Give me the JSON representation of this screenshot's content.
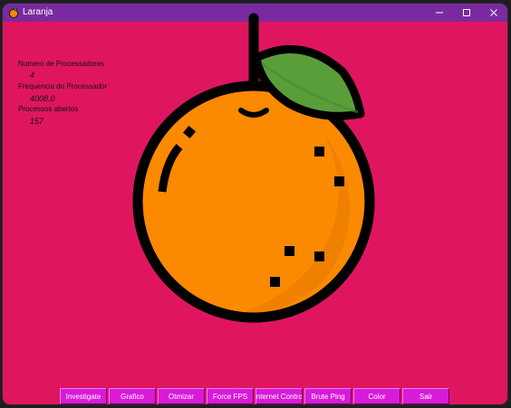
{
  "window": {
    "title": "Laranja"
  },
  "stats": [
    {
      "label": "Numero de Processadores",
      "value": "4"
    },
    {
      "label": "Frequencia do Processador",
      "value": "4008.0"
    },
    {
      "label": "Processos abertos",
      "value": "157"
    }
  ],
  "toolbar": {
    "buttons": [
      "Investigate",
      "Grafico",
      "Otmizar",
      "Force FPS",
      "Internet Control",
      "Brute Ping",
      "Color",
      "Sair"
    ]
  },
  "colors": {
    "background": "#e01560",
    "titlebar": "#7a2aa0",
    "button": "#d91ad9",
    "orange": "#fb8a00",
    "leaf": "#5a9e3a"
  },
  "icons": {
    "app": "orange-fruit-icon",
    "minimize": "minimize-icon",
    "maximize": "maximize-icon",
    "close": "close-icon",
    "illustration": "orange-fruit-illustration"
  }
}
